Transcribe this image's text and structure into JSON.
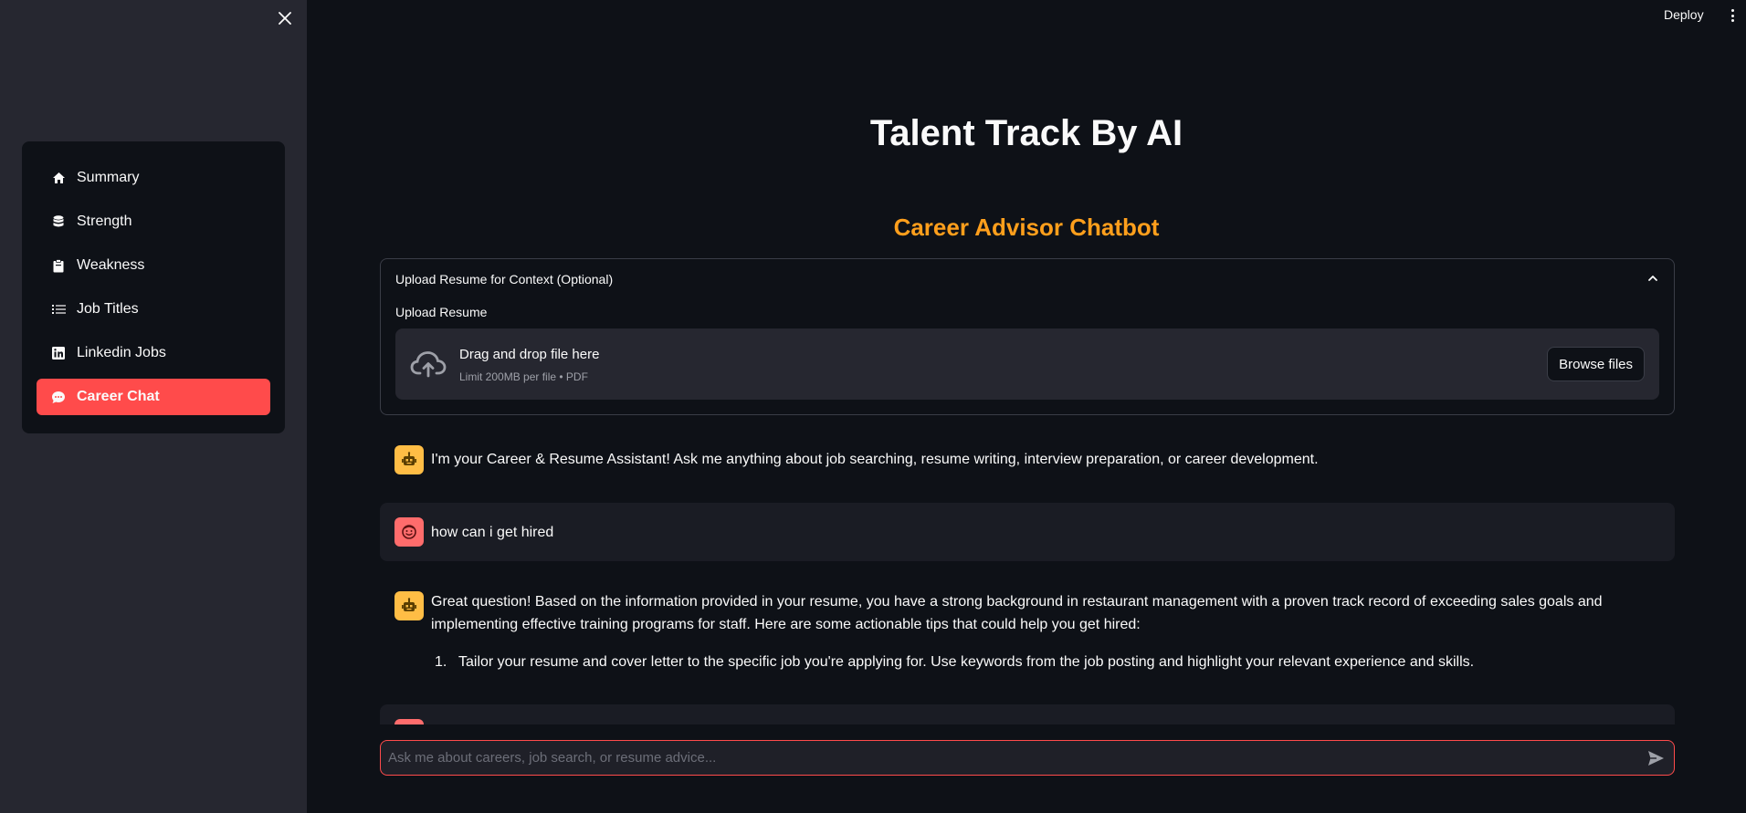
{
  "header": {
    "deploy_label": "Deploy"
  },
  "sidebar": {
    "items": [
      {
        "label": "Summary",
        "icon": "home-icon"
      },
      {
        "label": "Strength",
        "icon": "database-icon"
      },
      {
        "label": "Weakness",
        "icon": "clipboard-icon"
      },
      {
        "label": "Job Titles",
        "icon": "list-icon"
      },
      {
        "label": "Linkedin Jobs",
        "icon": "linkedin-icon"
      },
      {
        "label": "Career Chat",
        "icon": "chat-icon",
        "active": true
      }
    ],
    "active_color": "#ff4b4b"
  },
  "main": {
    "title": "Talent Track By AI",
    "subtitle": "Career Advisor Chatbot",
    "subtitle_color": "#ff9f1c",
    "expander": {
      "label": "Upload Resume for Context (Optional)",
      "upload_label": "Upload Resume",
      "drop_title": "Drag and drop file here",
      "drop_sub": "Limit 200MB per file • PDF",
      "browse_label": "Browse files"
    },
    "messages": [
      {
        "role": "assistant",
        "text": "I'm your Career & Resume Assistant! Ask me anything about job searching, resume writing, interview preparation, or career development."
      },
      {
        "role": "user",
        "text": "how can i get hired"
      },
      {
        "role": "assistant",
        "text": "Great question! Based on the information provided in your resume, you have a strong background in restaurant management with a proven track record of exceeding sales goals and implementing effective training programs for staff. Here are some actionable tips that could help you get hired:",
        "list": [
          {
            "num": "1.",
            "text": "Tailor your resume and cover letter to the specific job you're applying for. Use keywords from the job posting and highlight your relevant experience and skills."
          }
        ]
      }
    ],
    "chat_input": {
      "placeholder": "Ask me about careers, job search, or resume advice..."
    }
  }
}
